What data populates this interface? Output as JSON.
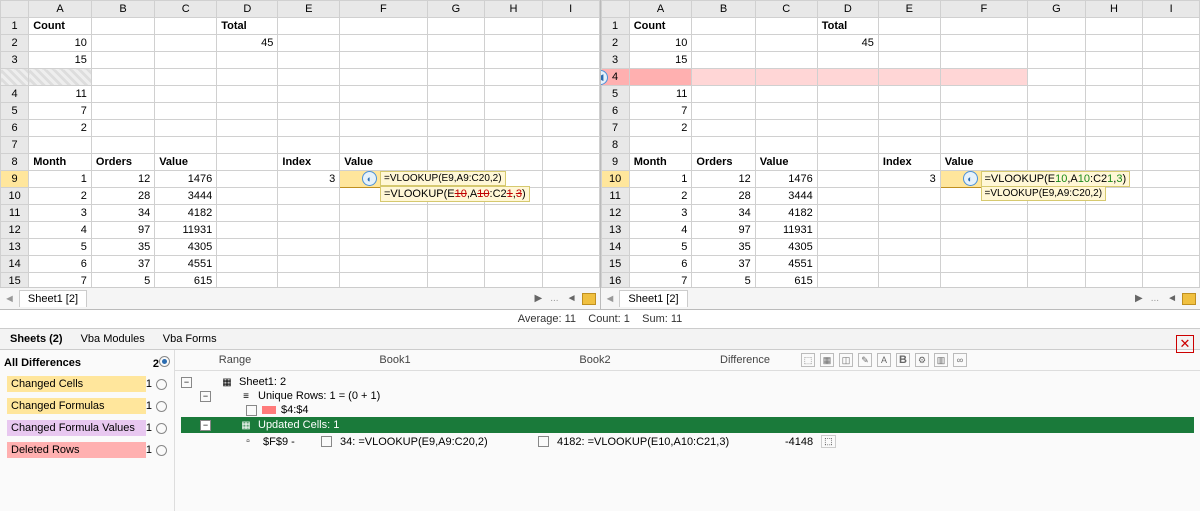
{
  "status": {
    "avg_label": "Average:",
    "avg_val": "11",
    "count_label": "Count:",
    "count_val": "1",
    "sum_label": "Sum:",
    "sum_val": "11"
  },
  "columns": [
    "A",
    "B",
    "C",
    "D",
    "E",
    "F",
    "G",
    "H",
    "I"
  ],
  "left": {
    "rows": [
      "1",
      "2",
      "3",
      "",
      "4",
      "5",
      "6",
      "7",
      "8",
      "9",
      "10",
      "11",
      "12",
      "13",
      "14",
      "15"
    ],
    "headers": {
      "count": "Count",
      "total": "Total",
      "month": "Month",
      "orders": "Orders",
      "value": "Value",
      "index": "Index",
      "value2": "Value"
    },
    "vals": {
      "A2": "10",
      "D2": "45",
      "A3": "15",
      "A4": "11",
      "A5": "7",
      "A6": "2",
      "A9": "1",
      "B9": "12",
      "C9": "1476",
      "E9": "3",
      "A10": "2",
      "B10": "28",
      "C10": "3444",
      "A11": "3",
      "B11": "34",
      "C11": "4182",
      "A12": "4",
      "B12": "97",
      "C12": "11931",
      "A13": "5",
      "B13": "35",
      "C13": "4305",
      "A14": "6",
      "B14": "37",
      "C14": "4551",
      "A15": "7",
      "B15": "5",
      "C15": "615"
    },
    "formula1": "=VLOOKUP(E9,A9:C20,2)",
    "formula2_pre": "=VLOOKUP(E",
    "formula2_r1": "10",
    "formula2_mid": ",A",
    "formula2_r2": "10",
    "formula2_mid2": ":C2",
    "formula2_r3": "1",
    "formula2_mid3": ",",
    "formula2_r4": "3",
    "formula2_post": ")",
    "tab": "Sheet1 [2]"
  },
  "right": {
    "rows": [
      "1",
      "2",
      "3",
      "4",
      "5",
      "6",
      "7",
      "8",
      "9",
      "10",
      "11",
      "12",
      "13",
      "14",
      "15",
      "16"
    ],
    "headers": {
      "count": "Count",
      "total": "Total",
      "month": "Month",
      "orders": "Orders",
      "value": "Value",
      "index": "Index",
      "value2": "Value"
    },
    "vals": {
      "A2": "10",
      "D2": "45",
      "A3": "15",
      "A5": "11",
      "A6": "7",
      "A7": "2",
      "A10": "1",
      "B10": "12",
      "C10": "1476",
      "E10": "3",
      "A11": "2",
      "B11": "28",
      "C11": "3444",
      "A12": "3",
      "B12": "34",
      "C12": "4182",
      "A13": "4",
      "B13": "97",
      "C13": "11931",
      "A14": "5",
      "B14": "35",
      "C14": "4305",
      "A15": "6",
      "B15": "37",
      "C15": "4551",
      "A16": "7",
      "B16": "5",
      "C16": "615"
    },
    "formula1_pre": "=VLOOKUP(E",
    "formula1_g1": "10",
    "formula1_mid": ",A",
    "formula1_g2": "10",
    "formula1_mid2": ":C2",
    "formula1_g3": "1",
    "formula1_mid3": ",",
    "formula1_g4": "3",
    "formula1_post": ")",
    "formula2": "=VLOOKUP(E9,A9:C20,2)",
    "tab": "Sheet1 [2]"
  },
  "bottom_tabs": {
    "sheets": "Sheets (2)",
    "modules": "Vba Modules",
    "forms": "Vba Forms"
  },
  "sidebar": {
    "title": "All Differences",
    "title_count": "2",
    "items": [
      {
        "label": "Changed Cells",
        "count": "1",
        "bg": "#ffe69c"
      },
      {
        "label": "Changed Formulas",
        "count": "1",
        "bg": "#ffe69c"
      },
      {
        "label": "Changed Formula Values",
        "count": "1",
        "bg": "#e8c8f0"
      },
      {
        "label": "Deleted Rows",
        "count": "1",
        "bg": "#ffb0b0"
      }
    ]
  },
  "diff_header": {
    "range": "Range",
    "book1": "Book1",
    "book2": "Book2",
    "difference": "Difference"
  },
  "tree": {
    "sheet": "Sheet1: 2",
    "unique": "Unique Rows: 1 = (0 + 1)",
    "row_ref": "$4:$4",
    "updated": "Updated Cells: 1",
    "detail_range": "$F$9 -",
    "detail_b1": "34: =VLOOKUP(E9,A9:C20,2)",
    "detail_b2": "4182: =VLOOKUP(E10,A10:C21,3)",
    "detail_diff": "-4148"
  }
}
